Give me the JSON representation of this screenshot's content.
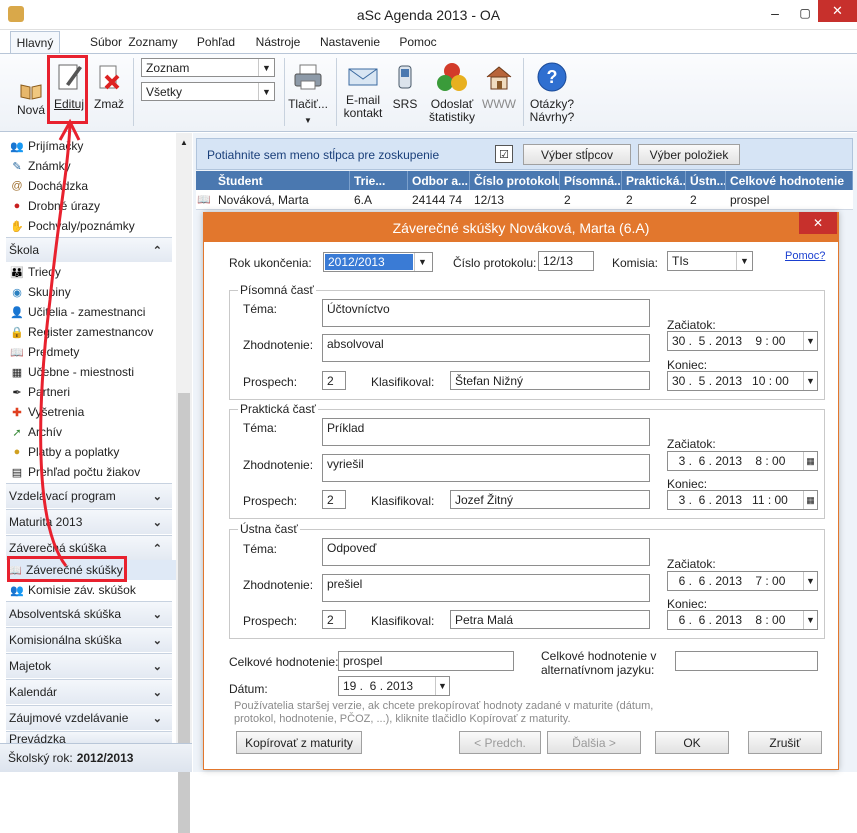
{
  "window": {
    "title": "aSc Agenda 2013 - OA"
  },
  "menu_tabs": [
    "Hlavný",
    "Súbor",
    "Zoznamy",
    "Pohľad",
    "Nástroje",
    "Nastavenie",
    "Pomoc"
  ],
  "ribbon": {
    "nova": "Nová",
    "edituj": "Edituj",
    "zmaz": "Zmaž",
    "combo1": "Zoznam",
    "combo2": "Všetky",
    "tlac": "Tlačiť...",
    "email": "E-mail kontakt",
    "sms": "SRS",
    "odoslat": "Odoslať štatistiky",
    "www": "WWW",
    "otazky": "Otázky? Návrhy?"
  },
  "sidebar": {
    "top_items": [
      "Prijímačky",
      "Známky",
      "Dochádzka",
      "Drobné úrazy",
      "Pochvaly/poznámky"
    ],
    "skola_header": "Škola",
    "skola_items": [
      "Triedy",
      "Skupiny",
      "Učitelia - zamestnanci",
      "Register zamestnancov",
      "Predmety",
      "Učebne - miestnosti",
      "Partneri",
      "Vyšetrenia",
      "Archív",
      "Platby a poplatky",
      "Prehľad počtu žiakov"
    ],
    "sections": [
      "Vzdelávací program",
      "Maturita 2013",
      "Záverečná skúška"
    ],
    "zav_items": [
      "Záverečné skúšky",
      "Komisie záv. skúšok"
    ],
    "sections_after": [
      "Absolventská skúška",
      "Komisionálna skúška",
      "Majetok",
      "Kalendár",
      "Záujmové vzdelávanie",
      "Prevádzka"
    ],
    "status_label": "Školský rok:",
    "status_value": "2012/2013"
  },
  "grid": {
    "group_hint": "Potiahnite sem meno stĺpca pre zoskupenie",
    "btn_columns": "Výber stĺpcov",
    "btn_items": "Výber položiek",
    "headers": [
      "Študent",
      "Trie...",
      "Odbor a...",
      "Číslo protokolu",
      "Písomná...",
      "Praktická...",
      "Ústn...",
      "Celkové hodnotenie"
    ],
    "row": [
      "Nováková, Marta",
      "6.A",
      "24144 74",
      "12/13",
      "2",
      "2",
      "2",
      "prospel"
    ]
  },
  "dialog": {
    "title": "Záverečné skúšky Nováková, Marta (6.A)",
    "close": "✕",
    "rok_label": "Rok ukončenia:",
    "rok_value": "2012/2013",
    "protokol_label": "Číslo protokolu:",
    "protokol_value": "12/13",
    "komisia_label": "Komisia:",
    "komisia_value": "TIs",
    "pomoc": "Pomoc?",
    "lbl_tema": "Téma:",
    "lbl_zhodnotenie": "Zhodnotenie:",
    "lbl_prospech": "Prospech:",
    "lbl_klasifikoval": "Klasifikoval:",
    "lbl_zaciatok": "Začiatok:",
    "lbl_koniec": "Koniec:",
    "sections": [
      {
        "title": "Písomná časť",
        "tema": "Účtovníctvo",
        "zhodnotenie": "absolvoval",
        "prospech": "2",
        "klasifikoval": "Štefan Nižný",
        "zaciatok": "30 .  5 . 2013    9 : 00",
        "koniec": "30 .  5 . 2013   10 : 00"
      },
      {
        "title": "Praktická časť",
        "tema": "Príklad",
        "zhodnotenie": "vyriešil",
        "prospech": "2",
        "klasifikoval": "Jozef Žitný",
        "zaciatok": "  3 .  6 . 2013    8 : 00",
        "koniec": "  3 .  6 . 2013   11 : 00"
      },
      {
        "title": "Ústna časť",
        "tema": "Odpoveď",
        "zhodnotenie": "prešiel",
        "prospech": "2",
        "klasifikoval": "Petra Malá",
        "zaciatok": "  6 .  6 . 2013    7 : 00",
        "koniec": "  6 .  6 . 2013    8 : 00"
      }
    ],
    "celkove_label": "Celkové hodnotenie:",
    "celkove_value": "prospel",
    "alt_label": "Celkové hodnotenie v alternatívnom jazyku:",
    "alt_value": "",
    "datum_label": "Dátum:",
    "datum_value": "19 .  6 . 2013",
    "hint": "Používatelia staršej verzie, ak chcete prekopírovať hodnoty zadané v maturite (dátum, protokol, hodnotenie, PČOZ, ...), kliknite tlačidlo Kopírovať z maturity.",
    "btn_copy": "Kopírovať z maturity",
    "btn_prev": "< Predch.",
    "btn_next": "Ďalšia >",
    "btn_ok": "OK",
    "btn_cancel": "Zrušiť"
  },
  "colors": {
    "accent": "#e2772d",
    "highlight": "#e8212e",
    "header_blue": "#4a78b0"
  }
}
